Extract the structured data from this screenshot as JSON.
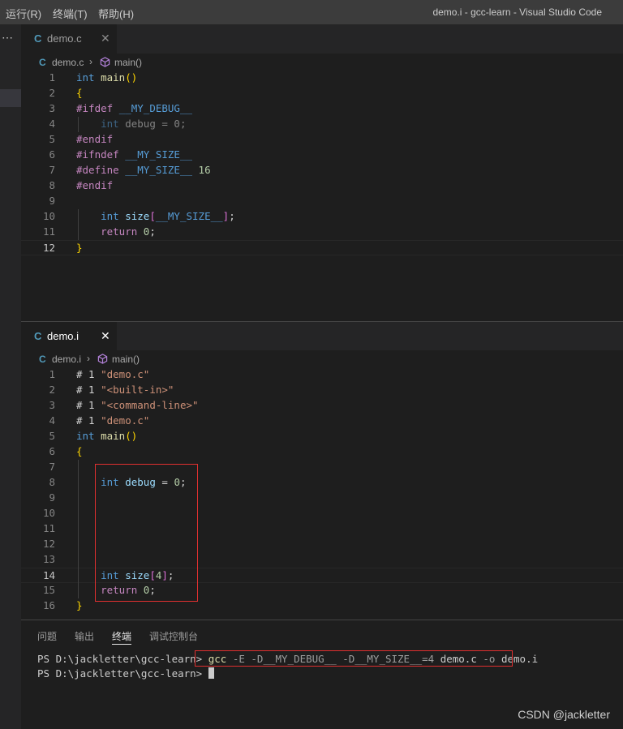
{
  "menu": [
    "运行(R)",
    "终端(T)",
    "帮助(H)"
  ],
  "window_title": "demo.i - gcc-learn - Visual Studio Code",
  "top_editor": {
    "tab": {
      "icon": "C",
      "label": "demo.c",
      "close": "✕"
    },
    "breadcrumb": {
      "file": "demo.c",
      "sep": "›",
      "symbol": "main()"
    },
    "lines": [
      {
        "n": "1",
        "tokens": [
          {
            "t": "int",
            "c": "kw"
          },
          {
            "t": " "
          },
          {
            "t": "main",
            "c": "fn"
          },
          {
            "t": "()",
            "c": "br"
          }
        ]
      },
      {
        "n": "2",
        "tokens": [
          {
            "t": "{",
            "c": "br"
          }
        ]
      },
      {
        "n": "3",
        "tokens": [
          {
            "t": "#ifdef",
            "c": "pp"
          },
          {
            "t": " "
          },
          {
            "t": "__MY_DEBUG__",
            "c": "mac"
          }
        ]
      },
      {
        "n": "4",
        "tokens": [
          {
            "t": "    "
          },
          {
            "t": "int",
            "c": "kw dim"
          },
          {
            "t": " debug = 0;",
            "c": "dim"
          }
        ]
      },
      {
        "n": "5",
        "tokens": [
          {
            "t": "#endif",
            "c": "pp"
          }
        ]
      },
      {
        "n": "6",
        "tokens": [
          {
            "t": "#ifndef",
            "c": "pp"
          },
          {
            "t": " "
          },
          {
            "t": "__MY_SIZE__",
            "c": "mac"
          }
        ]
      },
      {
        "n": "7",
        "tokens": [
          {
            "t": "#define",
            "c": "pp"
          },
          {
            "t": " "
          },
          {
            "t": "__MY_SIZE__",
            "c": "mac"
          },
          {
            "t": " "
          },
          {
            "t": "16",
            "c": "num"
          }
        ]
      },
      {
        "n": "8",
        "tokens": [
          {
            "t": "#endif",
            "c": "pp"
          }
        ]
      },
      {
        "n": "9",
        "tokens": []
      },
      {
        "n": "10",
        "tokens": [
          {
            "t": "    "
          },
          {
            "t": "int",
            "c": "kw"
          },
          {
            "t": " "
          },
          {
            "t": "size",
            "c": "vr"
          },
          {
            "t": "[",
            "c": "br2"
          },
          {
            "t": "__MY_SIZE__",
            "c": "mac"
          },
          {
            "t": "]",
            "c": "br2"
          },
          {
            "t": ";"
          }
        ]
      },
      {
        "n": "11",
        "tokens": [
          {
            "t": "    "
          },
          {
            "t": "return",
            "c": "pp"
          },
          {
            "t": " "
          },
          {
            "t": "0",
            "c": "num"
          },
          {
            "t": ";"
          }
        ]
      },
      {
        "n": "12",
        "tokens": [
          {
            "t": "}",
            "c": "br"
          }
        ],
        "active": true
      }
    ]
  },
  "bottom_editor": {
    "tab": {
      "icon": "C",
      "label": "demo.i",
      "close": "✕"
    },
    "breadcrumb": {
      "file": "demo.i",
      "sep": "›",
      "symbol": "main()"
    },
    "lines": [
      {
        "n": "1",
        "tokens": [
          {
            "t": "# 1 "
          },
          {
            "t": "\"demo.c\"",
            "c": "str"
          }
        ]
      },
      {
        "n": "2",
        "tokens": [
          {
            "t": "# 1 "
          },
          {
            "t": "\"<built-in>\"",
            "c": "str"
          }
        ]
      },
      {
        "n": "3",
        "tokens": [
          {
            "t": "# 1 "
          },
          {
            "t": "\"<command-line>\"",
            "c": "str"
          }
        ]
      },
      {
        "n": "4",
        "tokens": [
          {
            "t": "# 1 "
          },
          {
            "t": "\"demo.c\"",
            "c": "str"
          }
        ]
      },
      {
        "n": "5",
        "tokens": [
          {
            "t": "int",
            "c": "kw"
          },
          {
            "t": " "
          },
          {
            "t": "main",
            "c": "fn"
          },
          {
            "t": "()",
            "c": "br"
          }
        ]
      },
      {
        "n": "6",
        "tokens": [
          {
            "t": "{",
            "c": "br"
          }
        ]
      },
      {
        "n": "7",
        "tokens": []
      },
      {
        "n": "8",
        "tokens": [
          {
            "t": "    "
          },
          {
            "t": "int",
            "c": "kw"
          },
          {
            "t": " "
          },
          {
            "t": "debug",
            "c": "vr"
          },
          {
            "t": " = "
          },
          {
            "t": "0",
            "c": "num"
          },
          {
            "t": ";"
          }
        ]
      },
      {
        "n": "9",
        "tokens": []
      },
      {
        "n": "10",
        "tokens": []
      },
      {
        "n": "11",
        "tokens": []
      },
      {
        "n": "12",
        "tokens": []
      },
      {
        "n": "13",
        "tokens": []
      },
      {
        "n": "14",
        "tokens": [
          {
            "t": "    "
          },
          {
            "t": "int",
            "c": "kw"
          },
          {
            "t": " "
          },
          {
            "t": "size",
            "c": "vr"
          },
          {
            "t": "[",
            "c": "br2"
          },
          {
            "t": "4",
            "c": "num"
          },
          {
            "t": "]",
            "c": "br2"
          },
          {
            "t": ";"
          }
        ],
        "active": true
      },
      {
        "n": "15",
        "tokens": [
          {
            "t": "    "
          },
          {
            "t": "return",
            "c": "pp"
          },
          {
            "t": " "
          },
          {
            "t": "0",
            "c": "num"
          },
          {
            "t": ";"
          }
        ]
      },
      {
        "n": "16",
        "tokens": [
          {
            "t": "}",
            "c": "br"
          }
        ]
      }
    ]
  },
  "panel": {
    "tabs": [
      "问题",
      "输出",
      "终端",
      "调试控制台"
    ],
    "active_tab": "终端",
    "terminal": {
      "prompt1": "PS D:\\jackletter\\gcc-learn> ",
      "cmd_gcc": "gcc",
      "cmd_flags": " -E -D__MY_DEBUG__ -D__MY_SIZE__=4 ",
      "cmd_rest1": "demo.c",
      "cmd_o": " -o ",
      "cmd_rest2": "demo.i",
      "prompt2": "PS D:\\jackletter\\gcc-learn> "
    }
  },
  "watermark": "CSDN @jackletter",
  "colors": {
    "accent_box": "#e03030",
    "c_icon": "#519aba"
  }
}
